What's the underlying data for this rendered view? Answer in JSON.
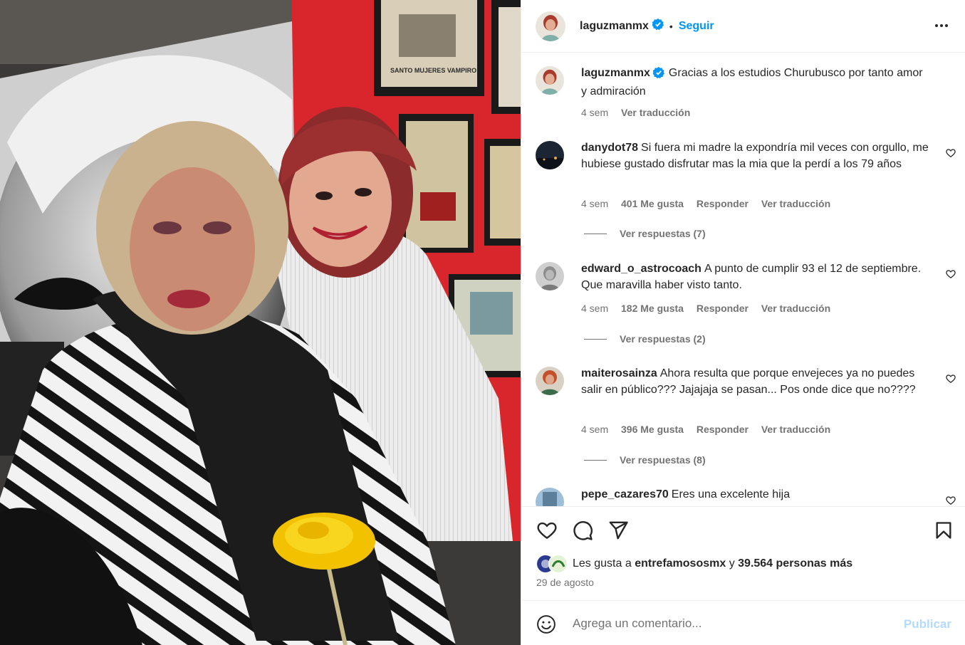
{
  "post": {
    "username": "laguzmanmx",
    "follow_label": "Seguir",
    "dot": "•",
    "caption": "Gracias a los estudios Churubusco por tanto amor y admiración",
    "caption_time": "4 sem",
    "caption_translate": "Ver traducción",
    "poster_text": "SANTO MUJERES VAMPIRO"
  },
  "comments": [
    {
      "username": "danydot78",
      "text": "Si fuera mi madre la expondría mil veces con orgullo, me hubiese gustado disfrutar mas la mia que la perdí a los 79 años",
      "time": "4 sem",
      "likes": "401 Me gusta",
      "reply": "Responder",
      "translate": "Ver traducción",
      "replies": "Ver respuestas (7)"
    },
    {
      "username": "edward_o_astrocoach",
      "text": "A punto de cumplir 93 el 12 de septiembre. Que maravilla haber visto tanto.",
      "time": "4 sem",
      "likes": "182 Me gusta",
      "reply": "Responder",
      "translate": "Ver traducción",
      "replies": "Ver respuestas (2)"
    },
    {
      "username": "maiterosainza",
      "text": "Ahora resulta que porque envejeces ya no puedes salir en público??? Jajajaja se pasan... Pos onde dice que no????",
      "time": "4 sem",
      "likes": "396 Me gusta",
      "reply": "Responder",
      "translate": "Ver traducción",
      "replies": "Ver respuestas (8)"
    },
    {
      "username": "pepe_cazares70",
      "text": "Eres una excelente hija"
    }
  ],
  "likes_summary": {
    "prefix": "Les gusta a",
    "user": "entrefamososmx",
    "joiner": "y",
    "others": "39.564 personas más"
  },
  "date": "29 de agosto",
  "composer": {
    "placeholder": "Agrega un comentario...",
    "post_label": "Publicar"
  },
  "colors": {
    "accent": "#0095f6",
    "post_disabled": "#b3dbff",
    "muted": "#737373",
    "text": "#262626"
  },
  "icons": [
    "more-options-icon",
    "heart-icon",
    "comment-icon",
    "share-icon",
    "save-icon",
    "emoji-icon",
    "verified-badge-icon"
  ]
}
